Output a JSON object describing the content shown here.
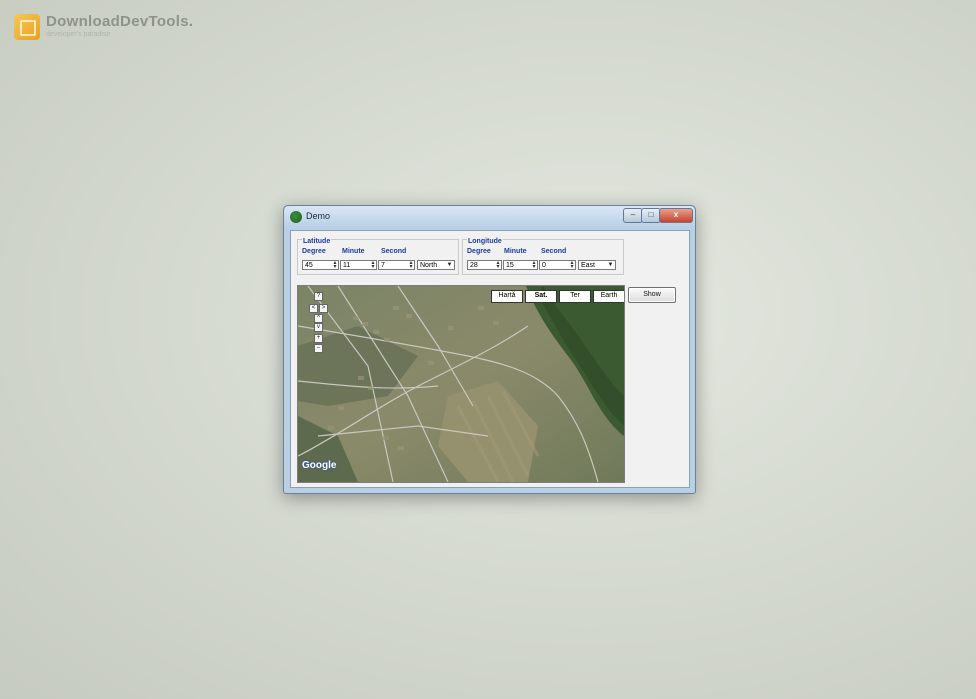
{
  "brand": {
    "name": "DownloadDevTools.",
    "tagline": "developer's paradise"
  },
  "window": {
    "title": "Demo",
    "controls": {
      "minimize": "–",
      "maximize": "□",
      "close": "x"
    }
  },
  "latitude": {
    "group_title": "Latitude",
    "labels": {
      "degree": "Degree",
      "minute": "Minute",
      "second": "Second"
    },
    "degree": "45",
    "minute": "11",
    "second": "7",
    "hemisphere": "North"
  },
  "longitude": {
    "group_title": "Longitude",
    "labels": {
      "degree": "Degree",
      "minute": "Minute",
      "second": "Second"
    },
    "degree": "28",
    "minute": "15",
    "second": "0",
    "hemisphere": "East"
  },
  "show_button": "Show",
  "map": {
    "types": [
      "Hartă",
      "Sat.",
      "Ter",
      "Earth"
    ],
    "active_type": "Sat.",
    "zoom_controls": [
      "?",
      "<",
      ">",
      "^",
      "v",
      "+",
      "–"
    ],
    "logo_text": "Google"
  }
}
